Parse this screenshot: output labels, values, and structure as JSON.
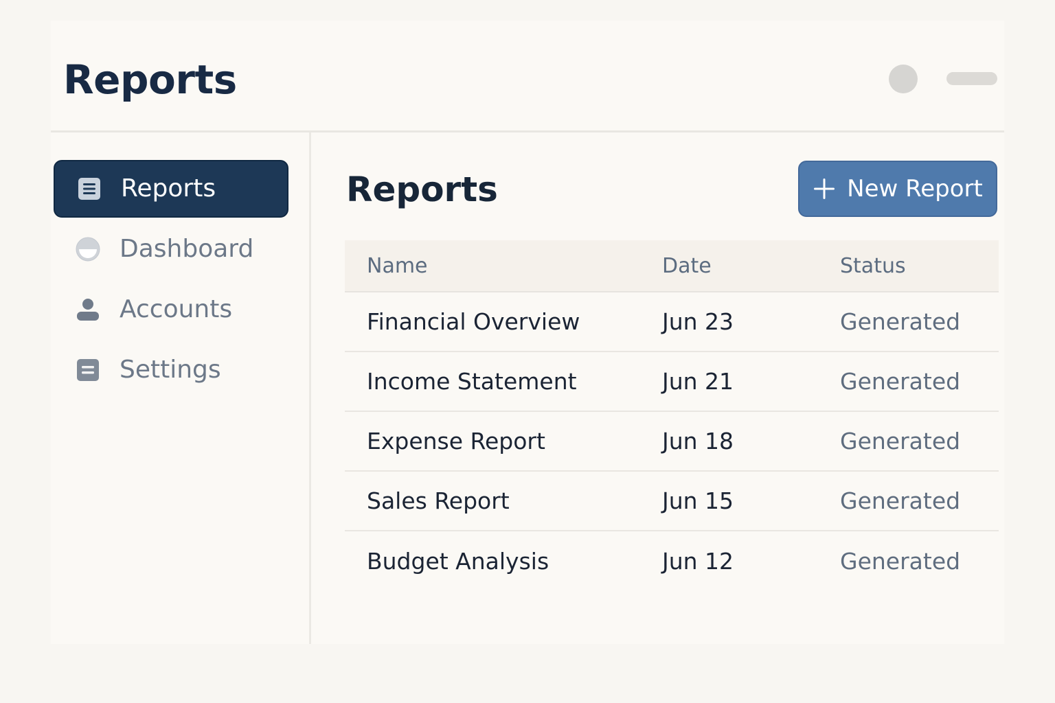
{
  "header": {
    "title": "Reports"
  },
  "sidebar": {
    "items": [
      {
        "label": "Reports",
        "icon": "reports-icon",
        "active": true
      },
      {
        "label": "Dashboard",
        "icon": "dashboard-icon",
        "active": false
      },
      {
        "label": "Accounts",
        "icon": "user-icon",
        "active": false
      },
      {
        "label": "Settings",
        "icon": "settings-icon",
        "active": false
      }
    ]
  },
  "main": {
    "title": "Reports",
    "new_report_label": "New Report",
    "table": {
      "columns": [
        "Name",
        "Date",
        "Status"
      ],
      "rows": [
        {
          "name": "Financial Overview",
          "date": "Jun 23",
          "status": "Generated"
        },
        {
          "name": "Income Statement",
          "date": "Jun 21",
          "status": "Generated"
        },
        {
          "name": "Expense Report",
          "date": "Jun 18",
          "status": "Generated"
        },
        {
          "name": "Sales Report",
          "date": "Jun 15",
          "status": "Generated"
        },
        {
          "name": "Budget Analysis",
          "date": "Jun 12",
          "status": "Generated"
        }
      ]
    }
  },
  "colors": {
    "active_nav_bg": "#1d3856",
    "primary_button": "#4f7aac",
    "page_bg": "#f8f6f2"
  }
}
